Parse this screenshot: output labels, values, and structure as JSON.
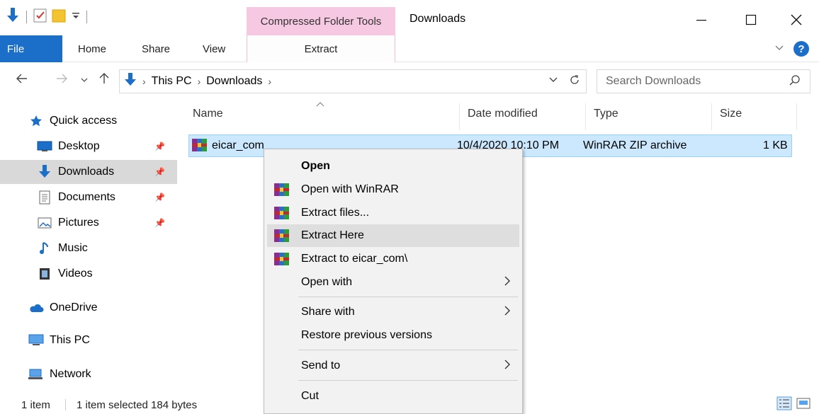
{
  "window": {
    "title": "Downloads",
    "contextual_tab_group": "Compressed Folder Tools"
  },
  "ribbon": {
    "tabs": {
      "file": "File",
      "home": "Home",
      "share": "Share",
      "view": "View",
      "extract": "Extract"
    }
  },
  "address": {
    "crumbs": [
      "This PC",
      "Downloads"
    ],
    "search_placeholder": "Search Downloads"
  },
  "sidebar": {
    "items": [
      {
        "label": "Quick access",
        "icon": "star-icon"
      },
      {
        "label": "Desktop",
        "icon": "desktop-icon",
        "pinned": true
      },
      {
        "label": "Downloads",
        "icon": "download-arrow-icon",
        "pinned": true,
        "selected": true
      },
      {
        "label": "Documents",
        "icon": "documents-icon",
        "pinned": true
      },
      {
        "label": "Pictures",
        "icon": "pictures-icon",
        "pinned": true
      },
      {
        "label": "Music",
        "icon": "music-icon"
      },
      {
        "label": "Videos",
        "icon": "videos-icon"
      },
      {
        "label": "OneDrive",
        "icon": "cloud-icon"
      },
      {
        "label": "This PC",
        "icon": "computer-icon"
      },
      {
        "label": "Network",
        "icon": "network-icon"
      }
    ]
  },
  "columns": {
    "name": "Name",
    "date": "Date modified",
    "type": "Type",
    "size": "Size"
  },
  "files": [
    {
      "name": "eicar_com",
      "date": "10/4/2020 10:10 PM",
      "type": "WinRAR ZIP archive",
      "size": "1 KB"
    }
  ],
  "context_menu": {
    "open": "Open",
    "open_with_winrar": "Open with WinRAR",
    "extract_files": "Extract files...",
    "extract_here": "Extract Here",
    "extract_to": "Extract to eicar_com\\",
    "open_with": "Open with",
    "share_with": "Share with",
    "restore": "Restore previous versions",
    "send_to": "Send to",
    "cut": "Cut"
  },
  "status": {
    "count": "1 item",
    "selection": "1 item selected  184 bytes"
  },
  "colors": {
    "accent": "#1c6fc9",
    "contextual_tab": "#f6c8e2",
    "selection": "#cce8ff"
  }
}
